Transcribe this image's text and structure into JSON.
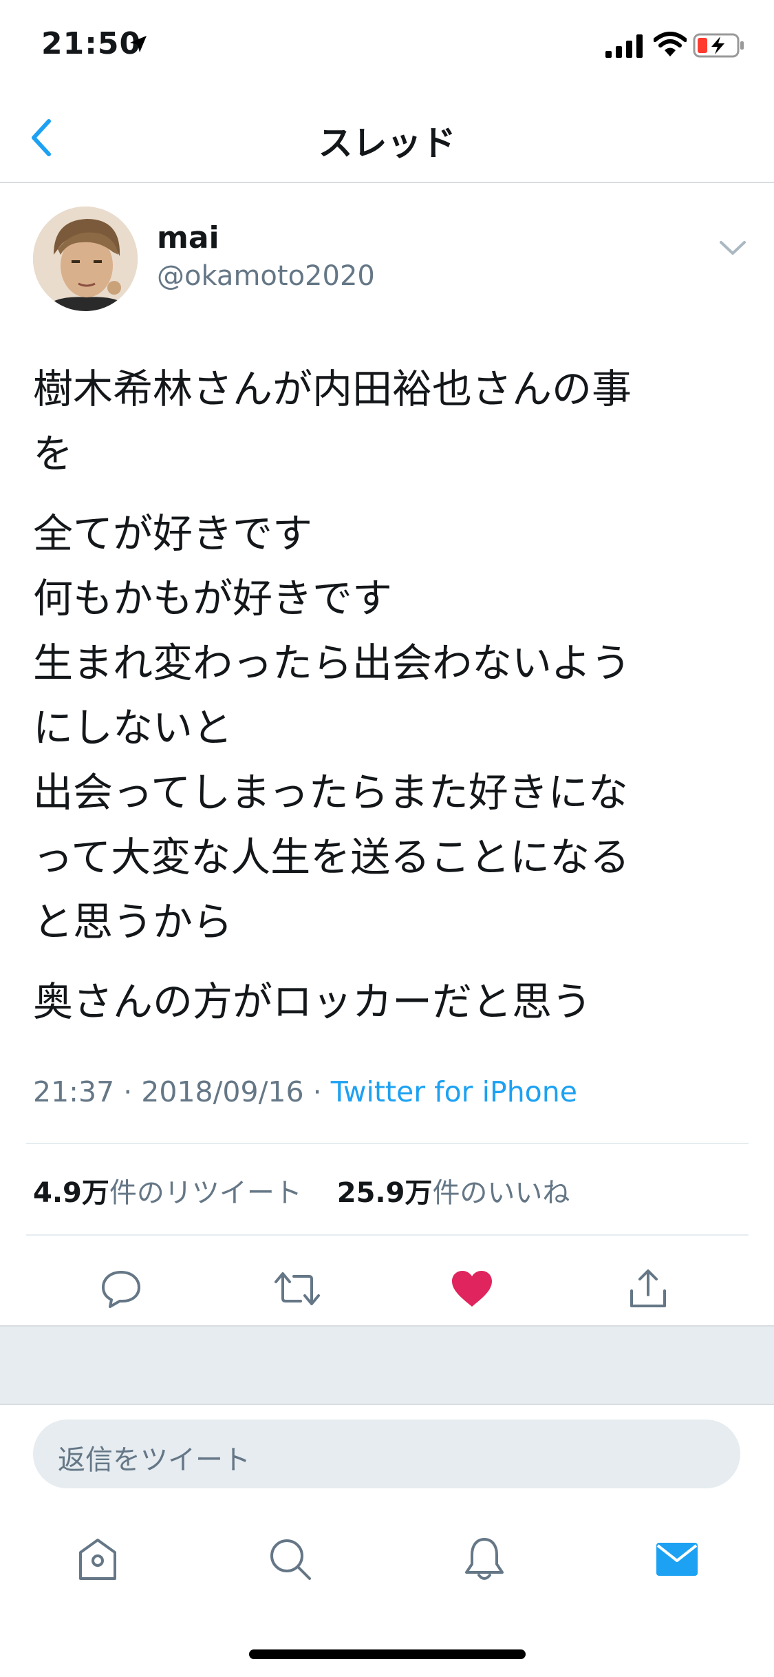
{
  "status_bar": {
    "time": "21:50"
  },
  "nav": {
    "title": "スレッド"
  },
  "tweet": {
    "user_name": "mai",
    "user_handle": "@okamoto2020",
    "paragraphs": [
      [
        "樹木希林さんが内田裕也さんの事",
        "を"
      ],
      [
        "全てが好きです",
        "何もかもが好きです",
        "生まれ変わったら出会わないよう",
        "にしないと",
        "出会ってしまったらまた好きにな",
        "って大変な人生を送ることになる",
        "と思うから"
      ],
      [
        "奥さんの方がロッカーだと思う"
      ]
    ],
    "time": "21:37",
    "date": "2018/09/16",
    "source": "Twitter for iPhone",
    "retweet_count": "4.9万",
    "retweet_label": "件のリツイート",
    "like_count": "25.9万",
    "like_label": "件のいいね"
  },
  "reply": {
    "placeholder": "返信をツイート"
  },
  "colors": {
    "accent": "#1da1f2",
    "like": "#e0245e",
    "secondary": "#657786"
  },
  "icons": [
    "location-arrow-icon",
    "signal-icon",
    "wifi-icon",
    "battery-icon",
    "back-chevron-icon",
    "chevron-down-icon",
    "reply-icon",
    "retweet-icon",
    "heart-icon",
    "share-icon",
    "home-icon",
    "search-icon",
    "bell-icon",
    "mail-icon"
  ]
}
